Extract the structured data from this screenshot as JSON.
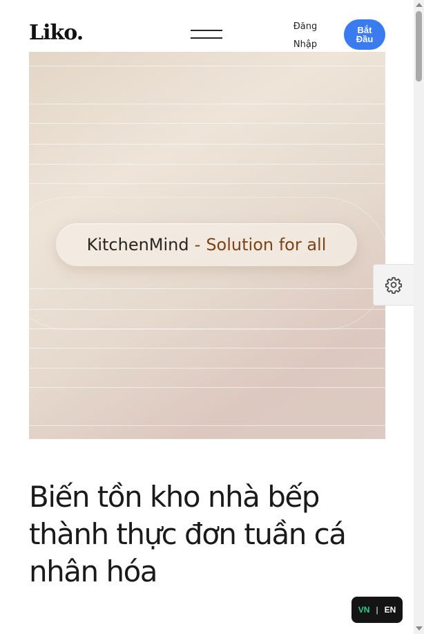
{
  "header": {
    "logo": "Liko.",
    "menu_icon": "hamburger-menu-icon",
    "login_line1": "Đăng",
    "login_line2": "Nhập",
    "start_label": "Bắt Đầu",
    "start_color": "#3a7bf0"
  },
  "hero": {
    "brand": "KitchenMind",
    "separator": "-",
    "slogan": "Solution for all",
    "slogan_color": "#7a4416"
  },
  "settings": {
    "icon": "gear-icon"
  },
  "headline": "Biến tồn kho nhà bếp thành thực đơn tuần cá nhân hóa",
  "language": {
    "active": "VN",
    "divider": "|",
    "other": "EN",
    "active_color": "#2fd08a"
  }
}
